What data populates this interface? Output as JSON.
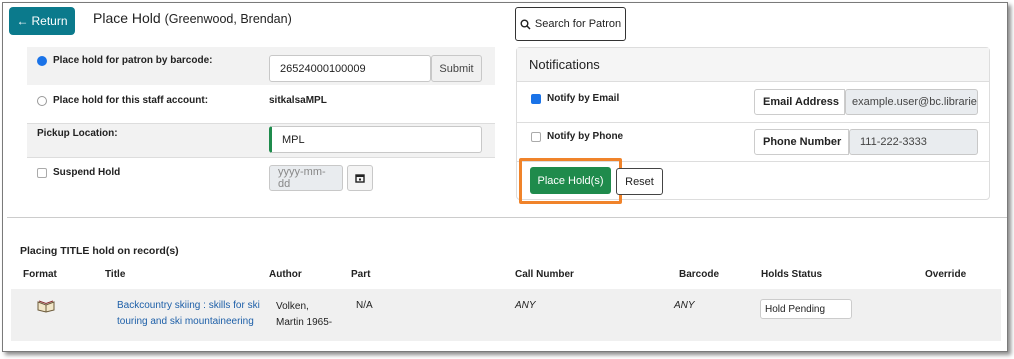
{
  "header": {
    "return_label": "Return",
    "title": "Place Hold",
    "patron_name": "(Greenwood, Brendan)",
    "search_patron_label": "Search for Patron"
  },
  "form": {
    "barcode_label": "Place hold for patron by barcode:",
    "barcode_value": "26524000100009",
    "submit_label": "Submit",
    "staff_label": "Place hold for this staff account:",
    "staff_account": "sitkalsaMPL",
    "pickup_label": "Pickup Location:",
    "pickup_value": "MPL",
    "suspend_label": "Suspend Hold",
    "suspend_placeholder": "yyyy-mm-dd"
  },
  "notifications": {
    "heading": "Notifications",
    "email_label": "Notify by Email",
    "email_field_label": "Email Address",
    "email_value": "example.user@bc.librarie",
    "phone_label": "Notify by Phone",
    "phone_field_label": "Phone Number",
    "phone_value": "111-222-3333",
    "place_holds_label": "Place Hold(s)",
    "reset_label": "Reset"
  },
  "records": {
    "heading": "Placing TITLE hold on record(s)",
    "columns": {
      "format": "Format",
      "title": "Title",
      "author": "Author",
      "part": "Part",
      "call_number": "Call Number",
      "barcode": "Barcode",
      "holds_status": "Holds Status",
      "override": "Override"
    },
    "rows": [
      {
        "title_line1": "Backcountry skiing : skills for ski",
        "title_line2": "touring and ski mountaineering",
        "author_line1": "Volken,",
        "author_line2": "Martin 1965-",
        "part": "N/A",
        "call_number": "ANY",
        "barcode": "ANY",
        "holds_status": "Hold Pending"
      }
    ]
  },
  "icons": {
    "return": "left-arrow-icon",
    "search": "search-icon",
    "calendar": "calendar-icon",
    "format": "book-icon"
  },
  "colors": {
    "return_button": "#0b7a8c",
    "place_hold_button": "#1f8b4c",
    "highlight": "#f0832a",
    "link": "#1d5fa8",
    "checked": "#1a73e8"
  }
}
